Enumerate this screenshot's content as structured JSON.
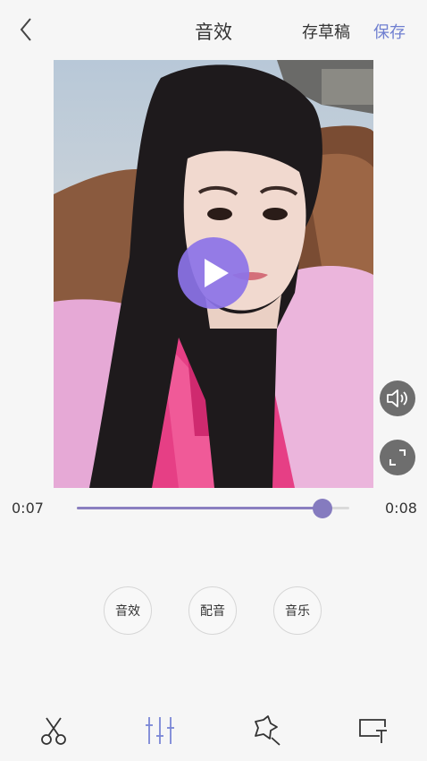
{
  "header": {
    "title": "音效",
    "draft_label": "存草稿",
    "save_label": "保存"
  },
  "player": {
    "current_time": "0:07",
    "total_time": "0:08",
    "progress": 0.9
  },
  "actions": [
    {
      "label": "音效"
    },
    {
      "label": "配音"
    },
    {
      "label": "音乐"
    }
  ],
  "toolbar": {
    "items": [
      {
        "icon": "scissors-icon"
      },
      {
        "icon": "sliders-icon",
        "active": true
      },
      {
        "icon": "magic-wand-icon"
      },
      {
        "icon": "text-box-icon"
      }
    ]
  },
  "colors": {
    "accent": "#6f7fd0",
    "play_button": "#8c73e8",
    "progress": "#857bbf"
  }
}
